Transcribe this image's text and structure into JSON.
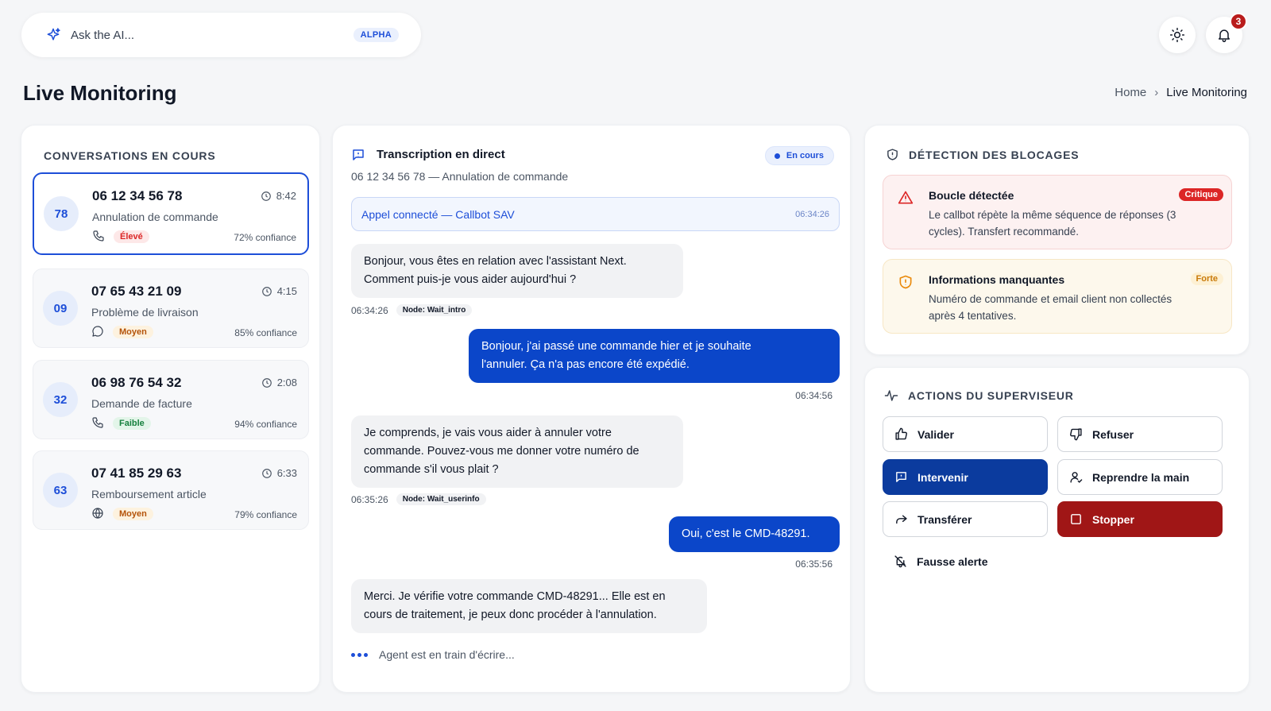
{
  "ai_bar": {
    "placeholder": "Ask the AI...",
    "badge": "ALPHA"
  },
  "header": {
    "notification_count": "3"
  },
  "page": {
    "title": "Live Monitoring"
  },
  "breadcrumb": {
    "home": "Home",
    "separator": "›",
    "current": "Live Monitoring"
  },
  "conversations": {
    "title": "CONVERSATIONS EN COURS",
    "items": [
      {
        "avatar": "78",
        "phone": "06 12 34 56 78",
        "time": "8:42",
        "reason": "Annulation de commande",
        "channel_icon": "phone-icon",
        "priority": "Élevé",
        "confidence": "72% confiance"
      },
      {
        "avatar": "09",
        "phone": "07 65 43 21 09",
        "time": "4:15",
        "reason": "Problème de livraison",
        "channel_icon": "chat-icon",
        "priority": "Moyen",
        "confidence": "85% confiance"
      },
      {
        "avatar": "32",
        "phone": "06 98 76 54 32",
        "time": "2:08",
        "reason": "Demande de facture",
        "channel_icon": "phone-icon",
        "priority": "Faible",
        "confidence": "94% confiance"
      },
      {
        "avatar": "63",
        "phone": "07 41 85 29 63",
        "time": "6:33",
        "reason": "Remboursement article",
        "channel_icon": "globe-icon",
        "priority": "Moyen",
        "confidence": "79% confiance"
      }
    ]
  },
  "transcription": {
    "title": "Transcription en direct",
    "subtitle": "06 12 34 56 78 — Annulation de commande",
    "status": "En cours",
    "system_message": {
      "text": "Appel connecté — Callbot SAV",
      "time": "06:34:26"
    },
    "messages": [
      {
        "text_1": "Bonjour, vous êtes en relation avec l'assistant Next.",
        "text_2": "Comment puis-je vous aider aujourd'hui ?",
        "time": "06:34:26",
        "node": "Node: Wait_intro"
      },
      {
        "text_1": "Bonjour, j'ai passé une commande hier et je souhaite",
        "text_2": "l'annuler. Ça n'a pas encore été expédié.",
        "time": "06:34:56"
      },
      {
        "text_1": "Je comprends, je vais vous aider à annuler votre",
        "text_2": "commande. Pouvez-vous me donner votre numéro de",
        "text_3": "commande s'il vous plait ?",
        "time": "06:35:26",
        "node": "Node: Wait_userinfo"
      },
      {
        "text_1": "Oui, c'est le CMD-48291.",
        "time": "06:35:56"
      },
      {
        "text_1": "Merci. Je vérifie votre commande CMD-48291... Elle est en",
        "text_2": "cours de traitement, je peux donc procéder à l'annulation."
      }
    ],
    "typing": "Agent est en train d'écrire..."
  },
  "detection": {
    "title": "DÉTECTION DES BLOCAGES",
    "alerts": [
      {
        "title": "Boucle détectée",
        "badge": "Critique",
        "desc_1": "Le callbot répète la même séquence de réponses (3",
        "desc_2": "cycles). Transfert recommandé."
      },
      {
        "title": "Informations manquantes",
        "badge": "Forte",
        "desc_1": "Numéro de commande et email client non collectés",
        "desc_2": "après 4 tentatives."
      }
    ]
  },
  "actions": {
    "title": "ACTIONS DU SUPERVISEUR",
    "validate": "Valider",
    "refuse": "Refuser",
    "intervene": "Intervenir",
    "take_over": "Reprendre la main",
    "transfer": "Transférer",
    "stop": "Stopper",
    "false_alarm": "Fausse alerte"
  },
  "colors": {
    "primary": "#1d4ed8",
    "primary_dark": "#0b3b9e",
    "danger": "#a01616",
    "critical": "#dc2626",
    "warning": "#ea8a0c"
  }
}
